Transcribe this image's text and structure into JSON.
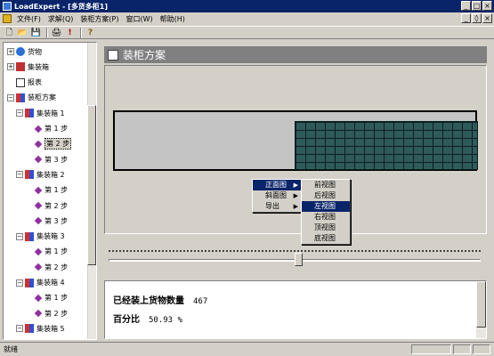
{
  "window": {
    "title": "LoadExpert - [多货多柜1]"
  },
  "menubar": {
    "items": [
      {
        "label": "文件(F)"
      },
      {
        "label": "求解(Q)"
      },
      {
        "label": "装柜方案(P)"
      },
      {
        "label": "窗口(W)"
      },
      {
        "label": "帮助(H)"
      }
    ]
  },
  "window_buttons": {
    "minimize": "_",
    "maximize": "□",
    "close": "×",
    "child_minimize": "_",
    "child_restore": "◊",
    "child_close": "×"
  },
  "toolbar": {
    "buttons": [
      {
        "icon": "new-file-icon",
        "glyph": "🗋"
      },
      {
        "icon": "open-folder-icon",
        "glyph": "📂"
      },
      {
        "icon": "save-icon",
        "glyph": "💾"
      },
      {
        "icon": "print-icon",
        "glyph": "🖨"
      },
      {
        "icon": "solve-icon",
        "glyph": "!"
      },
      {
        "icon": "help-icon",
        "glyph": "?"
      }
    ]
  },
  "tree": {
    "nodes": [
      {
        "label": "货物",
        "icon": "goods",
        "expander": "+",
        "level": 0
      },
      {
        "label": "集装箱",
        "icon": "container",
        "expander": "+",
        "level": 0
      },
      {
        "label": "报表",
        "icon": "report",
        "expander": "",
        "level": 0
      },
      {
        "label": "装柜方案",
        "icon": "plan",
        "expander": "−",
        "level": 0
      },
      {
        "label": "集装箱 1",
        "icon": "plan",
        "expander": "−",
        "level": 1
      },
      {
        "label": "第 1 步",
        "icon": "step",
        "expander": "",
        "level": 2
      },
      {
        "label": "第 2 步",
        "icon": "step",
        "expander": "",
        "level": 2,
        "selected": true
      },
      {
        "label": "第 3 步",
        "icon": "step",
        "expander": "",
        "level": 2
      },
      {
        "label": "集装箱 2",
        "icon": "plan",
        "expander": "−",
        "level": 1
      },
      {
        "label": "第 1 步",
        "icon": "step",
        "expander": "",
        "level": 2
      },
      {
        "label": "第 2 步",
        "icon": "step",
        "expander": "",
        "level": 2
      },
      {
        "label": "第 3 步",
        "icon": "step",
        "expander": "",
        "level": 2
      },
      {
        "label": "集装箱 3",
        "icon": "plan",
        "expander": "−",
        "level": 1
      },
      {
        "label": "第 1 步",
        "icon": "step",
        "expander": "",
        "level": 2
      },
      {
        "label": "第 2 步",
        "icon": "step",
        "expander": "",
        "level": 2
      },
      {
        "label": "集装箱 4",
        "icon": "plan",
        "expander": "−",
        "level": 1
      },
      {
        "label": "第 1 步",
        "icon": "step",
        "expander": "",
        "level": 2
      },
      {
        "label": "第 2 步",
        "icon": "step",
        "expander": "",
        "level": 2
      },
      {
        "label": "集装箱 5",
        "icon": "plan",
        "expander": "−",
        "level": 1
      }
    ]
  },
  "content": {
    "header_title": "装柜方案",
    "slider_position": 0.5
  },
  "context_menu": {
    "items": [
      {
        "label": "正面图",
        "has_submenu": true,
        "highlighted": true
      },
      {
        "label": "斜面图",
        "has_submenu": true,
        "highlighted": false
      },
      {
        "label": "导出",
        "has_submenu": true,
        "highlighted": false
      }
    ],
    "submenu_arrow": "▶"
  },
  "submenu": {
    "items": [
      {
        "label": "前视图",
        "highlighted": false
      },
      {
        "label": "后视图",
        "highlighted": false
      },
      {
        "label": "左视图",
        "highlighted": true
      },
      {
        "label": "右视图",
        "highlighted": false
      },
      {
        "label": "顶视图",
        "highlighted": false
      },
      {
        "label": "底视图",
        "highlighted": false
      }
    ]
  },
  "info": {
    "loaded_label": "已经装上货物数量",
    "loaded_value": "467",
    "percent_label": "百分比",
    "percent_value": "50.93 %"
  },
  "statusbar": {
    "text": "就绪"
  },
  "colors": {
    "titlebar": "#0a246a",
    "cargo_grid": "#2f5a5a",
    "highlight": "#0a246a"
  }
}
